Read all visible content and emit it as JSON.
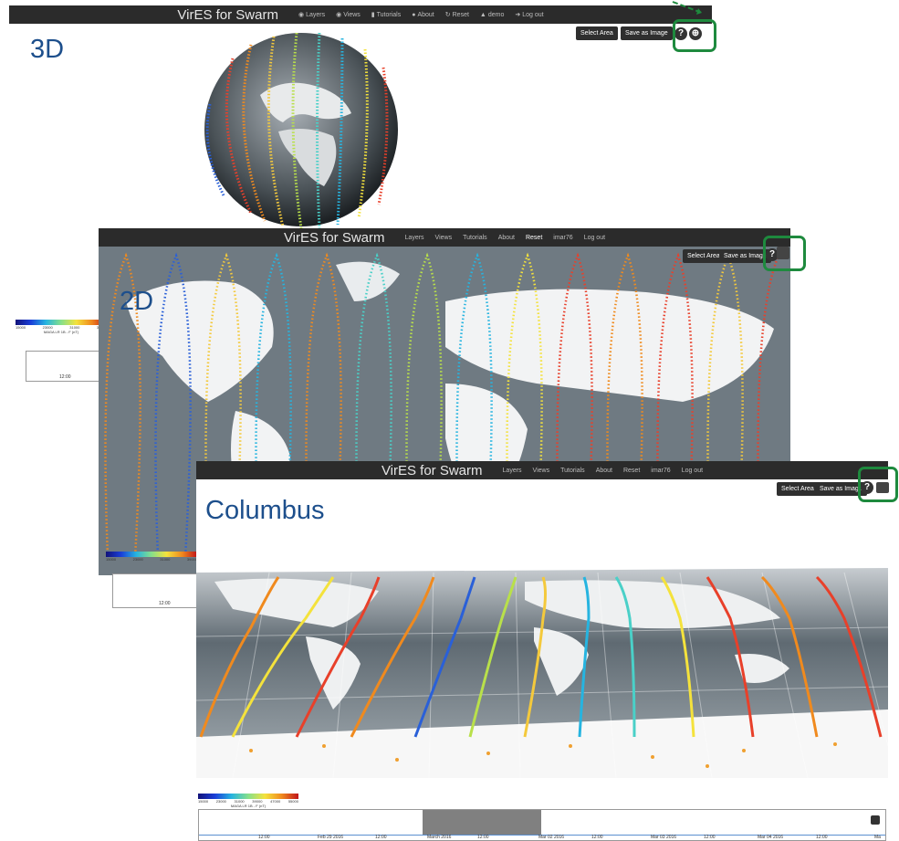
{
  "app": {
    "brand": "VirES for Swarm"
  },
  "nav_3d": {
    "items": [
      "Layers",
      "Views",
      "Tutorials",
      "About",
      "Reset",
      "demo",
      "Log out"
    ]
  },
  "nav_2d": {
    "items": [
      "Layers",
      "Views",
      "Tutorials",
      "About",
      "Reset",
      "imar76",
      "Log out"
    ]
  },
  "nav_col": {
    "items": [
      "Layers",
      "Views",
      "Tutorials",
      "About",
      "Reset",
      "imar76",
      "Log out"
    ]
  },
  "toolbar": {
    "select_area": "Select Area",
    "save_image": "Save as Image",
    "help": "?"
  },
  "tags": {
    "three_d": "3D",
    "two_d": "2D",
    "columbus": "Columbus"
  },
  "colorbar": {
    "ticks": [
      "15000",
      "23000",
      "31000",
      "39000",
      "47000",
      "55000"
    ],
    "title": "MAGA LR 1B - F (nT)"
  },
  "timeline_labels": [
    "12:00",
    "Feb 29 2016",
    "12:00",
    "March 2016",
    "12:00",
    "Mar 02 2016",
    "12:00",
    "Mar 03 2016",
    "12:00",
    "Mar 04 2016",
    "12:00",
    "Ma"
  ],
  "timeline_short": [
    "12:00"
  ],
  "colors": {
    "highlight": "#1e8a3e",
    "tag": "#1d4f8c",
    "navbar": "#2b2b2b"
  }
}
